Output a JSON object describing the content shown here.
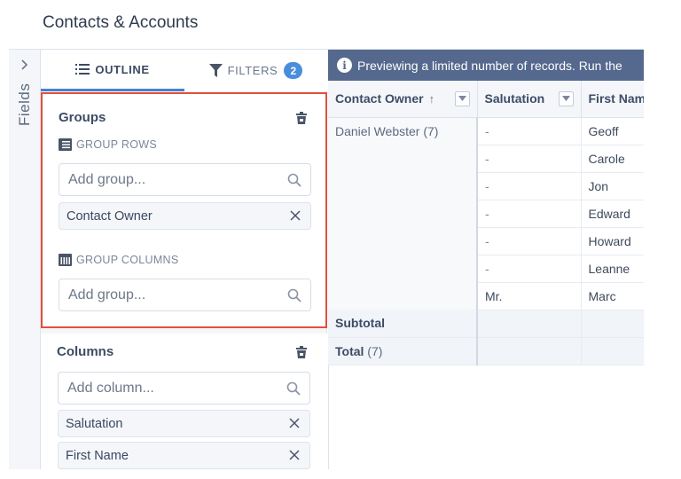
{
  "page": {
    "title": "Contacts & Accounts"
  },
  "rail": {
    "label": "Fields",
    "expand_icon": "chevron-right-icon"
  },
  "tabs": {
    "outline": {
      "label": "OUTLINE",
      "icon": "list-icon",
      "active": true
    },
    "filters": {
      "label": "FILTERS",
      "icon": "filter-icon",
      "badge": "2",
      "active": false
    }
  },
  "groups": {
    "title": "Groups",
    "rows_label": "GROUP ROWS",
    "rows_placeholder": "Add group...",
    "rows_items": [
      "Contact Owner"
    ],
    "columns_label": "GROUP COLUMNS",
    "columns_placeholder": "Add group..."
  },
  "columns": {
    "title": "Columns",
    "placeholder": "Add column...",
    "items": [
      "Salutation",
      "First Name"
    ]
  },
  "grid": {
    "banner": "Previewing a limited number of records. Run the",
    "headers": [
      {
        "label": "Contact Owner",
        "sort": "↑"
      },
      {
        "label": "Salutation"
      },
      {
        "label": "First Nam"
      }
    ],
    "group_owner": "Daniel Webster (7)",
    "rows": [
      {
        "salutation": "-",
        "first_name": "Geoff"
      },
      {
        "salutation": "-",
        "first_name": "Carole"
      },
      {
        "salutation": "-",
        "first_name": "Jon"
      },
      {
        "salutation": "-",
        "first_name": "Edward"
      },
      {
        "salutation": "-",
        "first_name": "Howard"
      },
      {
        "salutation": "-",
        "first_name": "Leanne"
      },
      {
        "salutation": "Mr.",
        "first_name": "Marc"
      }
    ],
    "subtotal_label": "Subtotal",
    "total_label": "Total",
    "total_count": "(7)"
  },
  "colors": {
    "accent_blue": "#4a7fd0",
    "highlight_border": "#e1503a",
    "banner_bg": "#54698d",
    "badge_bg": "#4a8ddc"
  }
}
